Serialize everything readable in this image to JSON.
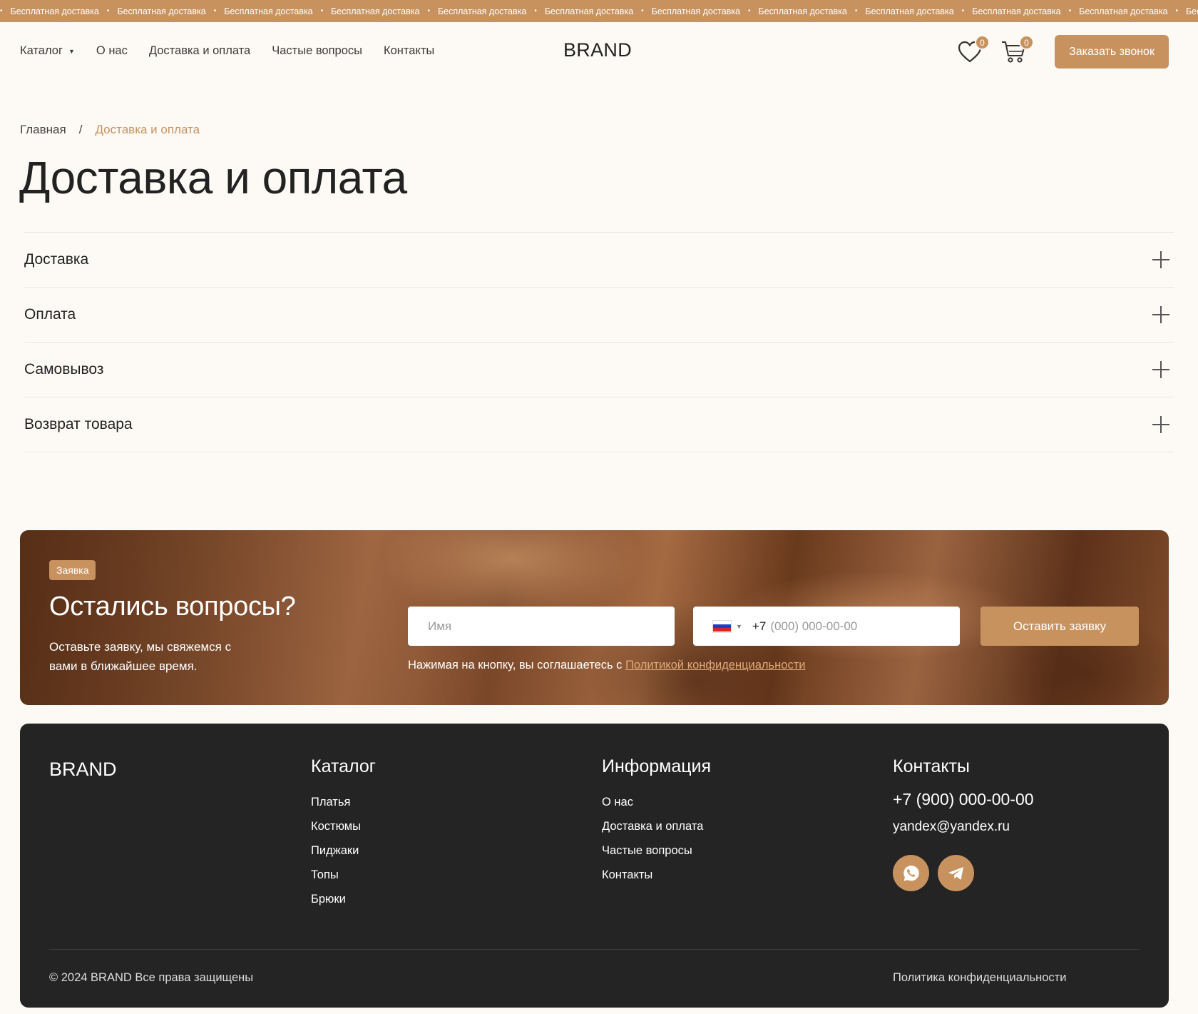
{
  "ticker": {
    "items": [
      "Бесплатная доставка",
      "Бесплатная доставка",
      "Бесплатная доставка",
      "Бесплатная доставка",
      "Бесплатная доставка",
      "Бесплатная доставка",
      "Бесплатная доставка",
      "Бесплатная доставка",
      "Бесплатная доставка",
      "Бесплатная доставка",
      "Бесплатная доставка",
      "Бесплатн"
    ],
    "separator": "•"
  },
  "header": {
    "nav": {
      "catalog": "Каталог",
      "about": "О нас",
      "delivery": "Доставка и оплата",
      "faq": "Частые вопросы",
      "contacts": "Контакты"
    },
    "logo": "BRAND",
    "favorites_count": "0",
    "cart_count": "0",
    "call_button": "Заказать звонок"
  },
  "breadcrumb": {
    "home": "Главная",
    "separator": "/",
    "current": "Доставка и оплата"
  },
  "page_title": "Доставка и оплата",
  "accordion": [
    "Доставка",
    "Оплата",
    "Самовывоз",
    "Возврат товара"
  ],
  "cta": {
    "badge": "Заявка",
    "title": "Остались вопросы?",
    "text": "Оставьте заявку, мы свяжемся с вами в ближайшее время.",
    "name_placeholder": "Имя",
    "phone_prefix": "+7",
    "phone_placeholder": "(000) 000-00-00",
    "submit": "Оставить заявку",
    "consent_text": "Нажимая на кнопку, вы соглашаетесь с ",
    "consent_link": "Политикой конфиденциальности"
  },
  "footer": {
    "logo": "BRAND",
    "catalog_title": "Каталог",
    "catalog_items": [
      "Платья",
      "Костюмы",
      "Пиджаки",
      "Топы",
      "Брюки"
    ],
    "info_title": "Информация",
    "info_items": [
      "О нас",
      "Доставка и оплата",
      "Частые вопросы",
      "Контакты"
    ],
    "contacts_title": "Контакты",
    "phone": "+7 (900) 000-00-00",
    "email": "yandex@yandex.ru",
    "copyright": "© 2024 BRAND Все права защищены",
    "policy": "Политика конфиденциальности"
  },
  "colors": {
    "accent": "#c8925f",
    "background": "#fdfaf5",
    "footer_bg": "#242424"
  },
  "icons": [
    "heart-icon",
    "cart-icon",
    "whatsapp-icon",
    "telegram-icon",
    "plus-icon",
    "flag-ru-icon"
  ]
}
